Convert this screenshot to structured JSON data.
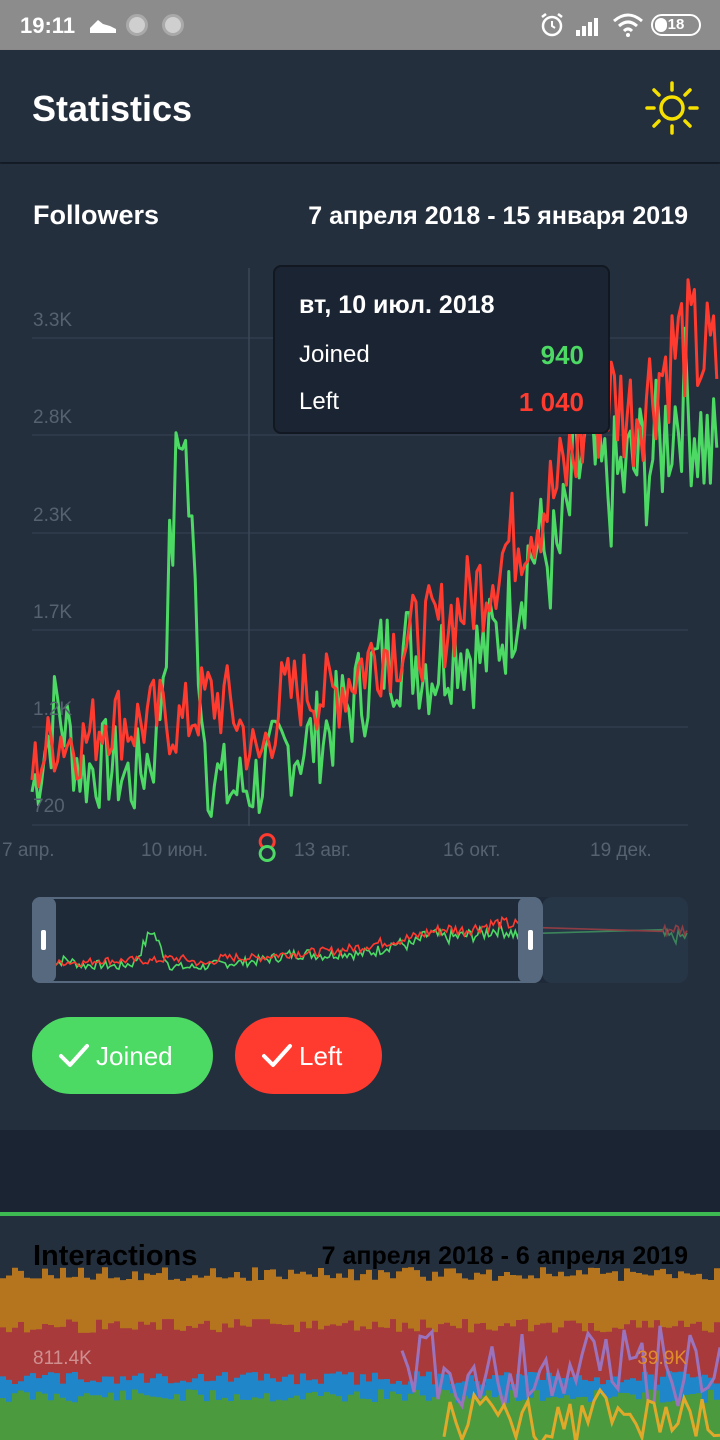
{
  "status_bar": {
    "time": "19:11",
    "battery": "18"
  },
  "app_bar": {
    "title": "Statistics"
  },
  "followers": {
    "title": "Followers",
    "date_range": "7 апреля 2018 - 15 января 2019",
    "tooltip": {
      "date": "вт, 10 июл. 2018",
      "joined_label": "Joined",
      "joined_value": "940",
      "left_label": "Left",
      "left_value": "1 040"
    },
    "toggles": {
      "joined": "Joined",
      "left": "Left"
    }
  },
  "interactions": {
    "title": "Interactions",
    "date_range": "7 апреля 2018 - 6 апреля 2019",
    "y_left": "811.4K",
    "y_right": "39.9K"
  },
  "colors": {
    "joined": "#4cd964",
    "left": "#ff3b30",
    "background": "#242f3e",
    "accent_sun": "#f5e000"
  },
  "chart_data": {
    "type": "line",
    "title": "Followers",
    "y_ticks": [
      "3.3K",
      "2.8K",
      "2.3K",
      "1.7K",
      "1.2K",
      "720"
    ],
    "x_ticks": [
      "7 апр.",
      "10 июн.",
      "13 авг.",
      "16 окт.",
      "19 дек."
    ],
    "ylim": [
      720,
      3700
    ],
    "x_range": [
      "2018-04-07",
      "2019-01-15"
    ],
    "legend": "toggle buttons below chart",
    "grid": true,
    "series": [
      {
        "name": "Joined",
        "color": "#4cd964",
        "dates": [
          "2018-04-07",
          "2018-04-17",
          "2018-04-27",
          "2018-05-07",
          "2018-05-17",
          "2018-05-27",
          "2018-06-06",
          "2018-06-16",
          "2018-06-26",
          "2018-07-06",
          "2018-07-16",
          "2018-07-26",
          "2018-08-05",
          "2018-08-15",
          "2018-08-25",
          "2018-09-04",
          "2018-09-14",
          "2018-09-24",
          "2018-10-04",
          "2018-10-14",
          "2018-10-24",
          "2018-11-03",
          "2018-11-13",
          "2018-11-23",
          "2018-12-03",
          "2018-12-13",
          "2018-12-23",
          "2019-01-02",
          "2019-01-15"
        ],
        "values": [
          900,
          1350,
          1000,
          1050,
          950,
          1150,
          2950,
          1000,
          900,
          950,
          1100,
          1150,
          1250,
          1400,
          1600,
          1650,
          1550,
          1700,
          1600,
          1800,
          2200,
          2100,
          2700,
          2500,
          2600,
          2700,
          3000,
          2700,
          2500
        ]
      },
      {
        "name": "Left",
        "color": "#ff3b30",
        "dates": [
          "2018-04-07",
          "2018-04-17",
          "2018-04-27",
          "2018-05-07",
          "2018-05-17",
          "2018-05-27",
          "2018-06-06",
          "2018-06-16",
          "2018-06-26",
          "2018-07-06",
          "2018-07-16",
          "2018-07-26",
          "2018-08-05",
          "2018-08-15",
          "2018-08-25",
          "2018-09-04",
          "2018-09-14",
          "2018-09-24",
          "2018-10-04",
          "2018-10-14",
          "2018-10-24",
          "2018-11-03",
          "2018-11-13",
          "2018-11-23",
          "2018-12-03",
          "2018-12-13",
          "2018-12-23",
          "2019-01-02",
          "2019-01-15"
        ],
        "values": [
          1000,
          1200,
          1150,
          1300,
          1250,
          1300,
          1250,
          1400,
          1350,
          1040,
          1400,
          1450,
          1400,
          1550,
          1650,
          1700,
          1750,
          1850,
          2000,
          2200,
          2350,
          2500,
          2800,
          3000,
          2900,
          3100,
          3300,
          3200,
          3000
        ]
      }
    ],
    "selected_point": {
      "date": "2018-07-10",
      "joined": 940,
      "left": 1040
    }
  }
}
